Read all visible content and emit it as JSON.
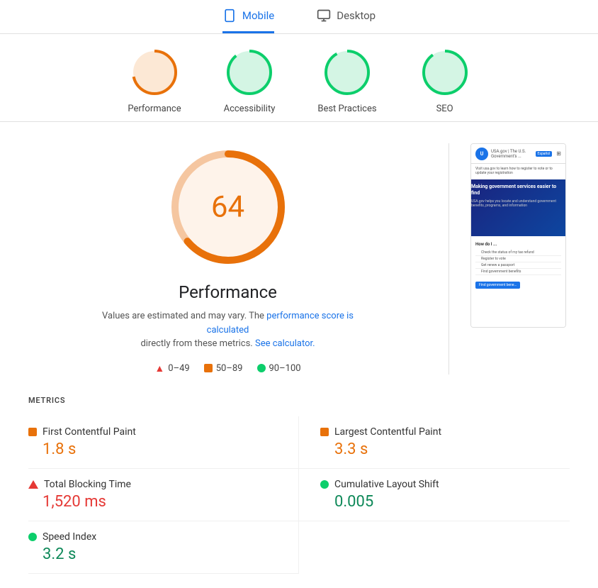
{
  "tabs": {
    "mobile_label": "Mobile",
    "desktop_label": "Desktop"
  },
  "score_circles": [
    {
      "id": "performance",
      "label": "Performance",
      "score": 64,
      "color": "#e8710a",
      "bg": "#fce8d5"
    },
    {
      "id": "accessibility",
      "label": "Accessibility",
      "score": 89,
      "color": "#0cce6b",
      "bg": "#d4f5e4"
    },
    {
      "id": "best_practices",
      "label": "Best Practices",
      "score": 92,
      "color": "#0cce6b",
      "bg": "#d4f5e4"
    },
    {
      "id": "seo",
      "label": "SEO",
      "score": 90,
      "color": "#0cce6b",
      "bg": "#d4f5e4"
    }
  ],
  "main": {
    "big_score": "64",
    "title": "Performance",
    "description_text": "Values are estimated and may vary. The",
    "link1_text": "performance score is calculated",
    "description_mid": "directly from these metrics.",
    "link2_text": "See calculator.",
    "legend": [
      {
        "id": "red",
        "range": "0–49"
      },
      {
        "id": "orange",
        "range": "50–89"
      },
      {
        "id": "green",
        "range": "90–100"
      }
    ]
  },
  "screenshot": {
    "header_text": "USA.gov | The U.S. Government's ...",
    "btn_text": "Español",
    "hero_title": "Making government services easier to find",
    "hero_sub": "USA.gov helps you locate and understand government benefits, programs, and information",
    "how_label": "How do I ...",
    "list_items": [
      "Check the status of my tax refund",
      "Register to vote",
      "Get renew a passport",
      "Find government benefits"
    ]
  },
  "metrics_section": {
    "title": "METRICS",
    "items": [
      {
        "id": "fcp",
        "indicator": "orange",
        "name": "First Contentful Paint",
        "value": "1.8 s",
        "color": "orange"
      },
      {
        "id": "lcp",
        "indicator": "orange",
        "name": "Largest Contentful Paint",
        "value": "3.3 s",
        "color": "orange"
      },
      {
        "id": "tbt",
        "indicator": "red",
        "name": "Total Blocking Time",
        "value": "1,520 ms",
        "color": "red"
      },
      {
        "id": "cls",
        "indicator": "green",
        "name": "Cumulative Layout Shift",
        "value": "0.005",
        "color": "green"
      },
      {
        "id": "si",
        "indicator": "green",
        "name": "Speed Index",
        "value": "3.2 s",
        "color": "green"
      }
    ]
  }
}
